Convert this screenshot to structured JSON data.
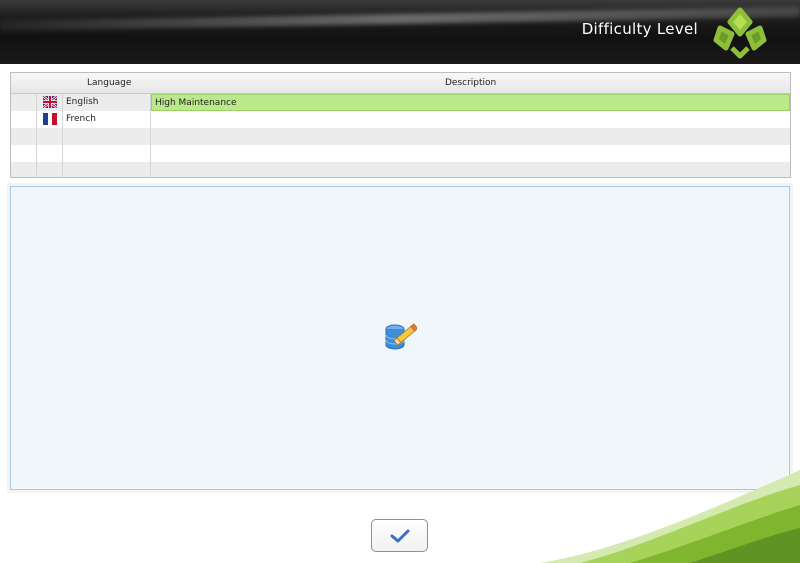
{
  "header": {
    "title": "Difficulty Level"
  },
  "grid": {
    "columns": [
      "Language",
      "Description"
    ],
    "rows": [
      {
        "flag_icon": "uk-flag-icon",
        "language": "English",
        "description": "High Maintenance",
        "selected": true
      },
      {
        "flag_icon": "france-flag-icon",
        "language": "French",
        "description": "",
        "selected": false
      },
      {
        "flag_icon": "",
        "language": "",
        "description": "",
        "selected": false
      },
      {
        "flag_icon": "",
        "language": "",
        "description": "",
        "selected": false
      },
      {
        "flag_icon": "",
        "language": "",
        "description": "",
        "selected": false
      }
    ]
  },
  "panel": {
    "icon": "database-edit-icon"
  },
  "footer": {
    "ok_icon": "checkmark-icon"
  },
  "colors": {
    "accent_green": "#b9e98a",
    "panel_bg": "#f1f6fb",
    "header_bg": "#111111"
  }
}
